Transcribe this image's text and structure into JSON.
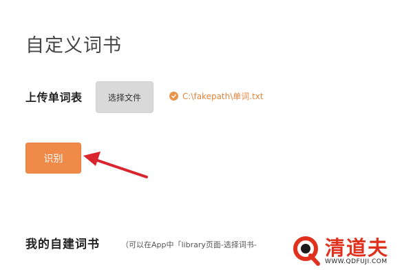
{
  "page": {
    "title": "自定义词书"
  },
  "upload": {
    "label": "上传单词表",
    "choose_button": "选择文件",
    "file_name": "C:\\fakepath\\单词.txt",
    "status_icon": "check-circle-icon"
  },
  "actions": {
    "recognize_label": "识别"
  },
  "my_books": {
    "title": "我的自建词书",
    "hint": "（可以在App中「library页面-选择词书-"
  },
  "watermark": {
    "brand": "清道夫",
    "url": "WWW.QDFUJI.COM"
  },
  "colors": {
    "accent": "#f08a49",
    "file_text": "#e4863e",
    "arrow": "#d8262f",
    "watermark_red": "#e0301e"
  }
}
